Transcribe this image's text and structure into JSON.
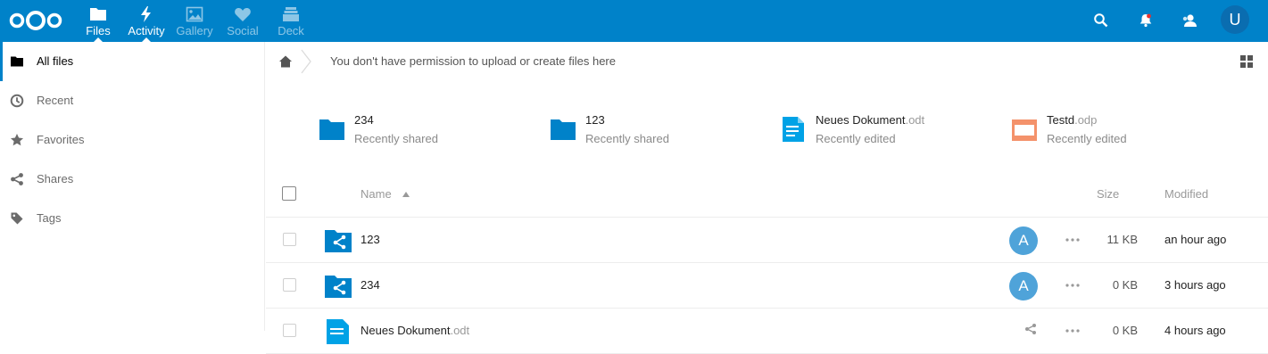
{
  "header": {
    "apps": [
      {
        "label": "Files",
        "icon": "folder-icon",
        "active": true
      },
      {
        "label": "Activity",
        "icon": "lightning-icon",
        "active": true
      },
      {
        "label": "Gallery",
        "icon": "image-icon",
        "active": false
      },
      {
        "label": "Social",
        "icon": "heart-icon",
        "active": false
      },
      {
        "label": "Deck",
        "icon": "deck-icon",
        "active": false
      }
    ],
    "avatar_letter": "U",
    "color": "#0082c9"
  },
  "sidebar": {
    "items": [
      {
        "label": "All files",
        "icon": "folder-icon"
      },
      {
        "label": "Recent",
        "icon": "clock-icon"
      },
      {
        "label": "Favorites",
        "icon": "star-icon"
      },
      {
        "label": "Shares",
        "icon": "share-icon"
      },
      {
        "label": "Tags",
        "icon": "tag-icon"
      }
    ]
  },
  "breadcrumb": {
    "permission_text": "You don't have permission to upload or create files here"
  },
  "recent": [
    {
      "name": "234",
      "ext": "",
      "sub": "Recently shared",
      "icon": "folder-icon"
    },
    {
      "name": "123",
      "ext": "",
      "sub": "Recently shared",
      "icon": "folder-icon"
    },
    {
      "name": "Neues Dokument",
      "ext": ".odt",
      "sub": "Recently edited",
      "icon": "document-icon"
    },
    {
      "name": "Testd",
      "ext": ".odp",
      "sub": "Recently edited",
      "icon": "presentation-icon"
    }
  ],
  "table": {
    "headers": {
      "name": "Name",
      "size": "Size",
      "modified": "Modified"
    },
    "rows": [
      {
        "name": "123",
        "ext": "",
        "owner": "A",
        "size": "11 KB",
        "modified": "an hour ago"
      },
      {
        "name": "234",
        "ext": "",
        "owner": "A",
        "size": "0 KB",
        "modified": "3 hours ago"
      },
      {
        "name": "Neues Dokument",
        "ext": ".odt",
        "owner": "",
        "size": "0 KB",
        "modified": "4 hours ago"
      }
    ]
  }
}
